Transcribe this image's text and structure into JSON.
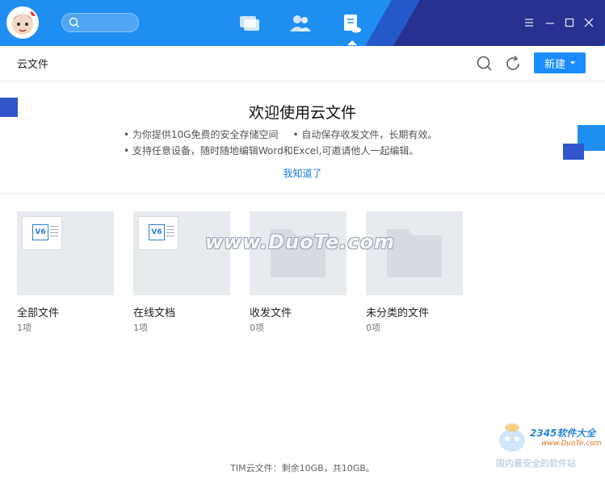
{
  "titlebar": {
    "search_placeholder": "",
    "nav": [
      {
        "name": "messages"
      },
      {
        "name": "contacts"
      },
      {
        "name": "cloud-files"
      }
    ]
  },
  "toolbar": {
    "title": "云文件",
    "new_button": "新建"
  },
  "welcome": {
    "heading": "欢迎使用云文件",
    "bullet1": "• 为你提供10G免费的安全存储空间",
    "bullet2": "• 自动保存收发文件，长期有效。",
    "bullet3": "• 支持任意设备，随时随地编辑Word和Excel,可邀请他人一起编辑。",
    "got_it": "我知道了"
  },
  "folders": [
    {
      "name": "全部文件",
      "count": "1项",
      "type": "doc"
    },
    {
      "name": "在线文档",
      "count": "1项",
      "type": "doc"
    },
    {
      "name": "收发文件",
      "count": "0项",
      "type": "folder"
    },
    {
      "name": "未分类的文件",
      "count": "0项",
      "type": "folder"
    }
  ],
  "footer": "TIM云文件：剩余10GB，共10GB。",
  "watermark": "www.DuoTe.com",
  "corner_logo": {
    "brand": "2345软件大全",
    "url": "www.DuoTe.com",
    "sub": "国内最安全的软件站"
  },
  "colors": {
    "titlebar_blue": "#1f8ef1",
    "titlebar_dark": "#27318f",
    "accent": "#1a8cff",
    "link": "#1a7bd8"
  }
}
